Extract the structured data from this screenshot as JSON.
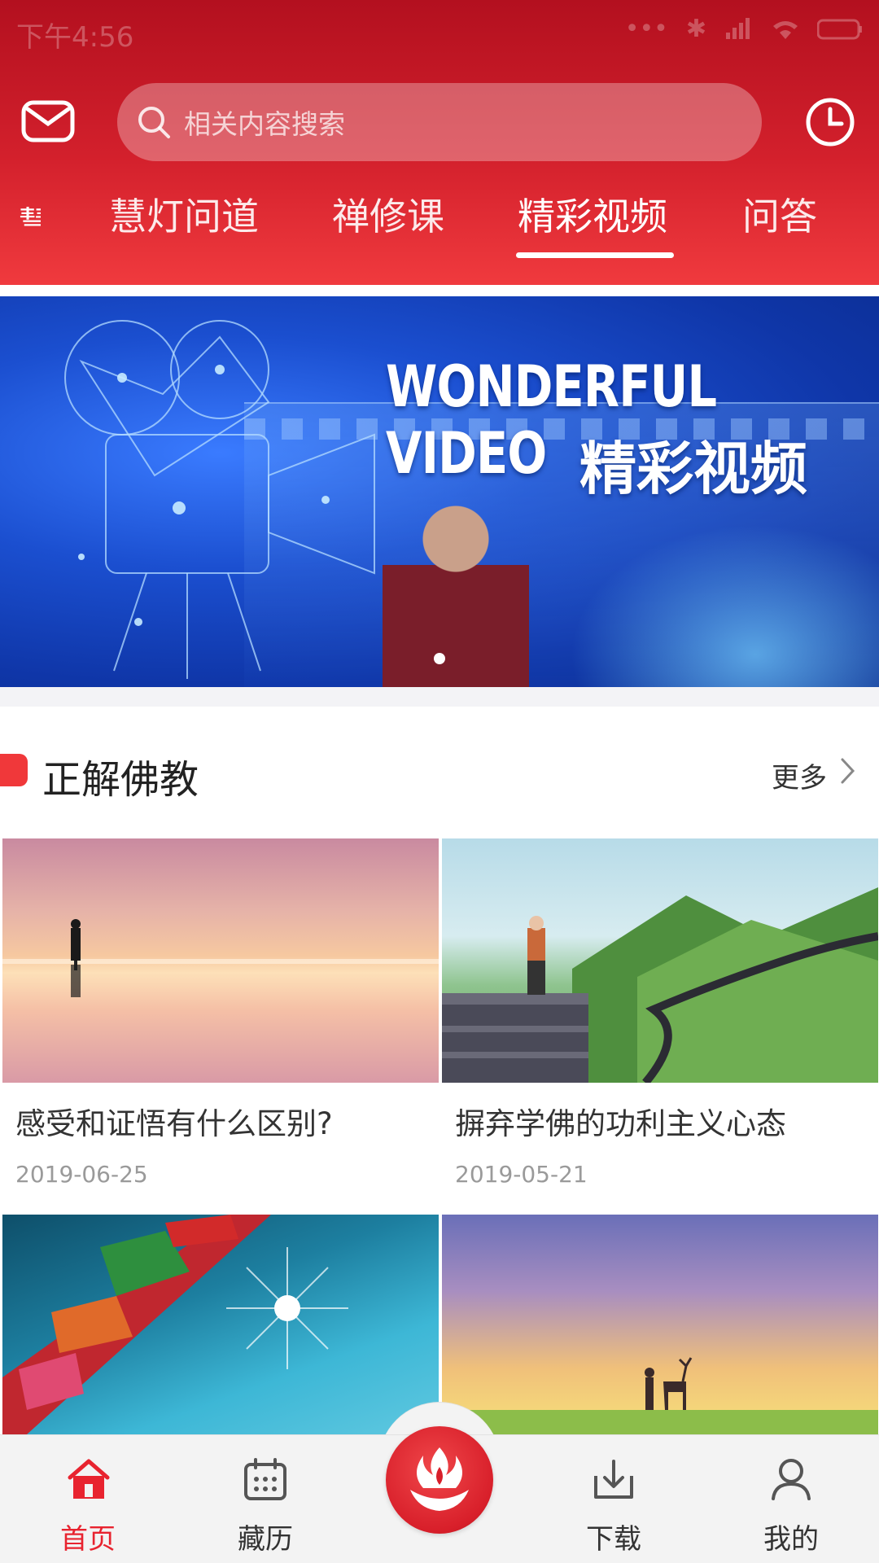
{
  "status_bar": {
    "time": "下午4:56"
  },
  "header": {
    "search_placeholder": "相关内容搜索",
    "tabs": [
      "慧灯问道",
      "禅修课",
      "精彩视频",
      "问答"
    ],
    "active_tab_index": 2
  },
  "banner": {
    "title_en": "WONDERFUL VIDEO",
    "title_cn": "精彩视频"
  },
  "section": {
    "title": "正解佛教",
    "more_label": "更多"
  },
  "cards": [
    {
      "title": "感受和证悟有什么区别?",
      "date": "2019-06-25"
    },
    {
      "title": "摒弃学佛的功利主义心态",
      "date": "2019-05-21"
    }
  ],
  "bottom_nav": {
    "items": [
      "首页",
      "藏历",
      "下载",
      "我的"
    ],
    "active_index": 0
  },
  "colors": {
    "brand_red": "#e8232f",
    "header_top": "#b3101f",
    "header_bottom": "#f03a3e"
  }
}
